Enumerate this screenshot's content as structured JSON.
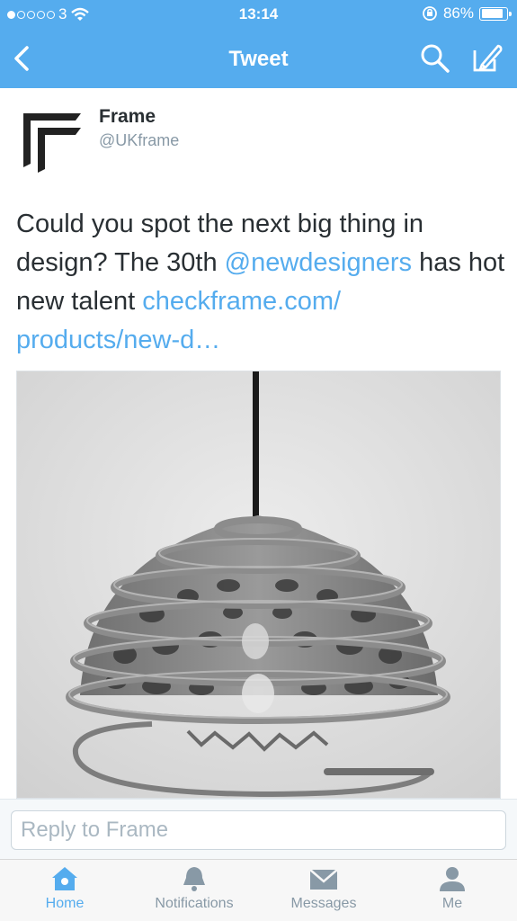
{
  "status_bar": {
    "carrier": "3",
    "time": "13:14",
    "battery_percent": "86%",
    "signal_bars_filled": 1,
    "signal_bars_total": 5,
    "battery_level": 0.86
  },
  "nav": {
    "title": "Tweet",
    "background": "#55acee",
    "back_icon": "chevron-left-icon",
    "search_icon": "search-icon",
    "compose_icon": "compose-icon"
  },
  "tweet": {
    "author_name": "Frame",
    "author_handle": "@UKframe",
    "text_part1": "Could you spot the next big thing in design? The 30th ",
    "mention": "@newdesigners",
    "text_part2": " has hot new talent ",
    "link": "checkframe.com/ products/new-d…",
    "media_icon": "pendant-lamp-photo",
    "link_color": "#55acee"
  },
  "reply": {
    "placeholder": "Reply to Frame"
  },
  "tabbar": {
    "tabs": [
      {
        "label": "Home",
        "icon": "home-icon",
        "active": true
      },
      {
        "label": "Notifications",
        "icon": "bell-icon",
        "active": false
      },
      {
        "label": "Messages",
        "icon": "envelope-icon",
        "active": false
      },
      {
        "label": "Me",
        "icon": "person-icon",
        "active": false
      }
    ]
  }
}
